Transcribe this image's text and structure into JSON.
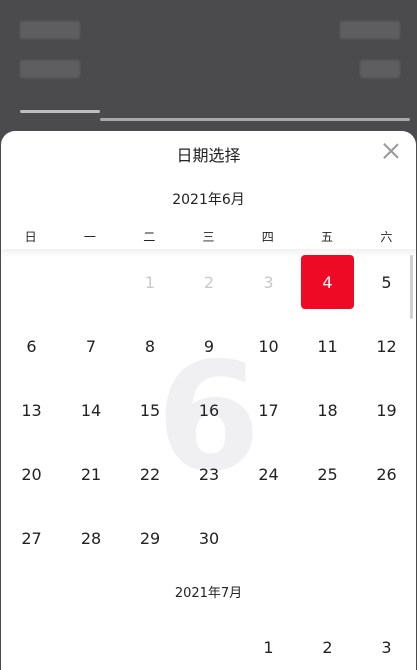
{
  "sheet": {
    "title": "日期选择"
  },
  "month1": {
    "title": "2021年6月",
    "watermark": "6",
    "days": [
      {
        "label": "1",
        "state": "disabled"
      },
      {
        "label": "2",
        "state": "disabled"
      },
      {
        "label": "3",
        "state": "disabled"
      },
      {
        "label": "4",
        "state": "selected"
      },
      {
        "label": "5",
        "state": "normal"
      },
      {
        "label": "6",
        "state": "normal"
      },
      {
        "label": "7",
        "state": "normal"
      },
      {
        "label": "8",
        "state": "normal"
      },
      {
        "label": "9",
        "state": "normal"
      },
      {
        "label": "10",
        "state": "normal"
      },
      {
        "label": "11",
        "state": "normal"
      },
      {
        "label": "12",
        "state": "normal"
      },
      {
        "label": "13",
        "state": "normal"
      },
      {
        "label": "14",
        "state": "normal"
      },
      {
        "label": "15",
        "state": "normal"
      },
      {
        "label": "16",
        "state": "normal"
      },
      {
        "label": "17",
        "state": "normal"
      },
      {
        "label": "18",
        "state": "normal"
      },
      {
        "label": "19",
        "state": "normal"
      },
      {
        "label": "20",
        "state": "normal"
      },
      {
        "label": "21",
        "state": "normal"
      },
      {
        "label": "22",
        "state": "normal"
      },
      {
        "label": "23",
        "state": "normal"
      },
      {
        "label": "24",
        "state": "normal"
      },
      {
        "label": "25",
        "state": "normal"
      },
      {
        "label": "26",
        "state": "normal"
      },
      {
        "label": "27",
        "state": "normal"
      },
      {
        "label": "28",
        "state": "normal"
      },
      {
        "label": "29",
        "state": "normal"
      },
      {
        "label": "30",
        "state": "normal"
      }
    ]
  },
  "weekdays": [
    "日",
    "一",
    "二",
    "三",
    "四",
    "五",
    "六"
  ],
  "month2": {
    "title": "2021年7月",
    "days": [
      {
        "label": "1",
        "state": "normal"
      },
      {
        "label": "2",
        "state": "normal"
      },
      {
        "label": "3",
        "state": "normal"
      }
    ]
  },
  "colors": {
    "accent": "#ee0a24",
    "disabled": "#c8c9cc",
    "overlay": "#4b4b4d"
  }
}
